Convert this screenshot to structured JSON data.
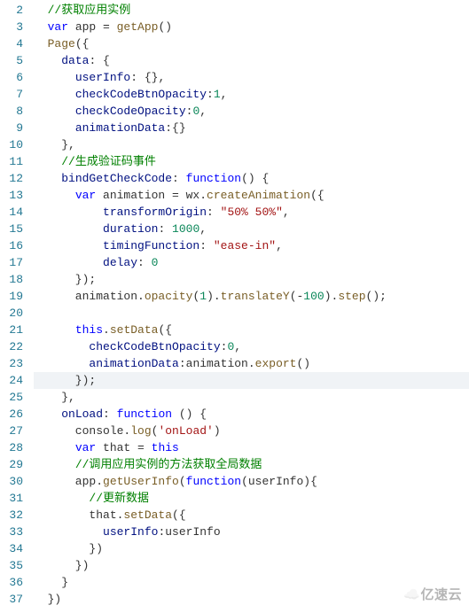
{
  "lines": [
    {
      "n": 2,
      "tokens": [
        [
          "  ",
          "punct"
        ],
        [
          "//获取应用实例",
          "comment"
        ]
      ]
    },
    {
      "n": 3,
      "tokens": [
        [
          "  ",
          "punct"
        ],
        [
          "var",
          "kw"
        ],
        [
          " app = ",
          "punct"
        ],
        [
          "getApp",
          "func"
        ],
        [
          "()",
          "punct"
        ]
      ]
    },
    {
      "n": 4,
      "tokens": [
        [
          "  ",
          "punct"
        ],
        [
          "Page",
          "func"
        ],
        [
          "({",
          "punct"
        ]
      ]
    },
    {
      "n": 5,
      "tokens": [
        [
          "    ",
          "punct"
        ],
        [
          "data",
          "ident"
        ],
        [
          ": {",
          "punct"
        ]
      ]
    },
    {
      "n": 6,
      "tokens": [
        [
          "      ",
          "punct"
        ],
        [
          "userInfo",
          "ident"
        ],
        [
          ": {},",
          "punct"
        ]
      ]
    },
    {
      "n": 7,
      "tokens": [
        [
          "      ",
          "punct"
        ],
        [
          "checkCodeBtnOpacity",
          "ident"
        ],
        [
          ":",
          "punct"
        ],
        [
          "1",
          "num"
        ],
        [
          ",",
          "punct"
        ]
      ]
    },
    {
      "n": 8,
      "tokens": [
        [
          "      ",
          "punct"
        ],
        [
          "checkCodeOpacity",
          "ident"
        ],
        [
          ":",
          "punct"
        ],
        [
          "0",
          "num"
        ],
        [
          ",",
          "punct"
        ]
      ]
    },
    {
      "n": 9,
      "tokens": [
        [
          "      ",
          "punct"
        ],
        [
          "animationData",
          "ident"
        ],
        [
          ":{}",
          "punct"
        ]
      ]
    },
    {
      "n": 10,
      "tokens": [
        [
          "    },",
          "punct"
        ]
      ]
    },
    {
      "n": 11,
      "tokens": [
        [
          "    ",
          "punct"
        ],
        [
          "//生成验证码事件",
          "comment"
        ]
      ]
    },
    {
      "n": 12,
      "tokens": [
        [
          "    ",
          "punct"
        ],
        [
          "bindGetCheckCode",
          "ident"
        ],
        [
          ": ",
          "punct"
        ],
        [
          "function",
          "kw"
        ],
        [
          "() {",
          "punct"
        ]
      ]
    },
    {
      "n": 13,
      "tokens": [
        [
          "      ",
          "punct"
        ],
        [
          "var",
          "kw"
        ],
        [
          " animation = wx.",
          "punct"
        ],
        [
          "createAnimation",
          "func"
        ],
        [
          "({",
          "punct"
        ]
      ]
    },
    {
      "n": 14,
      "tokens": [
        [
          "          ",
          "punct"
        ],
        [
          "transformOrigin",
          "ident"
        ],
        [
          ": ",
          "punct"
        ],
        [
          "\"50% 50%\"",
          "str"
        ],
        [
          ",",
          "punct"
        ]
      ]
    },
    {
      "n": 15,
      "tokens": [
        [
          "          ",
          "punct"
        ],
        [
          "duration",
          "ident"
        ],
        [
          ": ",
          "punct"
        ],
        [
          "1000",
          "num"
        ],
        [
          ",",
          "punct"
        ]
      ]
    },
    {
      "n": 16,
      "tokens": [
        [
          "          ",
          "punct"
        ],
        [
          "timingFunction",
          "ident"
        ],
        [
          ": ",
          "punct"
        ],
        [
          "\"ease-in\"",
          "str"
        ],
        [
          ",",
          "punct"
        ]
      ]
    },
    {
      "n": 17,
      "tokens": [
        [
          "          ",
          "punct"
        ],
        [
          "delay",
          "ident"
        ],
        [
          ": ",
          "punct"
        ],
        [
          "0",
          "num"
        ]
      ]
    },
    {
      "n": 18,
      "tokens": [
        [
          "      });",
          "punct"
        ]
      ]
    },
    {
      "n": 19,
      "tokens": [
        [
          "      animation.",
          "punct"
        ],
        [
          "opacity",
          "func"
        ],
        [
          "(",
          "punct"
        ],
        [
          "1",
          "num"
        ],
        [
          ").",
          "punct"
        ],
        [
          "translateY",
          "func"
        ],
        [
          "(-",
          "punct"
        ],
        [
          "100",
          "num"
        ],
        [
          ").",
          "punct"
        ],
        [
          "step",
          "func"
        ],
        [
          "();",
          "punct"
        ]
      ]
    },
    {
      "n": 20,
      "tokens": [
        [
          "",
          "punct"
        ]
      ]
    },
    {
      "n": 21,
      "tokens": [
        [
          "      ",
          "punct"
        ],
        [
          "this",
          "kw"
        ],
        [
          ".",
          "punct"
        ],
        [
          "setData",
          "func"
        ],
        [
          "({",
          "punct"
        ]
      ]
    },
    {
      "n": 22,
      "tokens": [
        [
          "        ",
          "punct"
        ],
        [
          "checkCodeBtnOpacity",
          "ident"
        ],
        [
          ":",
          "punct"
        ],
        [
          "0",
          "num"
        ],
        [
          ",",
          "punct"
        ]
      ]
    },
    {
      "n": 23,
      "tokens": [
        [
          "        ",
          "punct"
        ],
        [
          "animationData",
          "ident"
        ],
        [
          ":animation.",
          "punct"
        ],
        [
          "export",
          "func"
        ],
        [
          "()",
          "punct"
        ]
      ]
    },
    {
      "n": 24,
      "hl": true,
      "tokens": [
        [
          "      });",
          "punct"
        ]
      ]
    },
    {
      "n": 25,
      "tokens": [
        [
          "    },",
          "punct"
        ]
      ]
    },
    {
      "n": 26,
      "tokens": [
        [
          "    ",
          "punct"
        ],
        [
          "onLoad",
          "ident"
        ],
        [
          ": ",
          "punct"
        ],
        [
          "function",
          "kw"
        ],
        [
          " () {",
          "punct"
        ]
      ]
    },
    {
      "n": 27,
      "tokens": [
        [
          "      console.",
          "punct"
        ],
        [
          "log",
          "func"
        ],
        [
          "(",
          "punct"
        ],
        [
          "'onLoad'",
          "str"
        ],
        [
          ")",
          "punct"
        ]
      ]
    },
    {
      "n": 28,
      "tokens": [
        [
          "      ",
          "punct"
        ],
        [
          "var",
          "kw"
        ],
        [
          " that = ",
          "punct"
        ],
        [
          "this",
          "kw"
        ]
      ]
    },
    {
      "n": 29,
      "tokens": [
        [
          "      ",
          "punct"
        ],
        [
          "//调用应用实例的方法获取全局数据",
          "comment"
        ]
      ]
    },
    {
      "n": 30,
      "tokens": [
        [
          "      app.",
          "punct"
        ],
        [
          "getUserInfo",
          "func"
        ],
        [
          "(",
          "punct"
        ],
        [
          "function",
          "kw"
        ],
        [
          "(userInfo){",
          "punct"
        ]
      ]
    },
    {
      "n": 31,
      "tokens": [
        [
          "        ",
          "punct"
        ],
        [
          "//更新数据",
          "comment"
        ]
      ]
    },
    {
      "n": 32,
      "tokens": [
        [
          "        that.",
          "punct"
        ],
        [
          "setData",
          "func"
        ],
        [
          "({",
          "punct"
        ]
      ]
    },
    {
      "n": 33,
      "tokens": [
        [
          "          ",
          "punct"
        ],
        [
          "userInfo",
          "ident"
        ],
        [
          ":userInfo",
          "punct"
        ]
      ]
    },
    {
      "n": 34,
      "tokens": [
        [
          "        })",
          "punct"
        ]
      ]
    },
    {
      "n": 35,
      "tokens": [
        [
          "      })",
          "punct"
        ]
      ]
    },
    {
      "n": 36,
      "tokens": [
        [
          "    }",
          "punct"
        ]
      ]
    },
    {
      "n": 37,
      "tokens": [
        [
          "  })",
          "punct"
        ]
      ]
    }
  ],
  "watermark": "亿速云"
}
